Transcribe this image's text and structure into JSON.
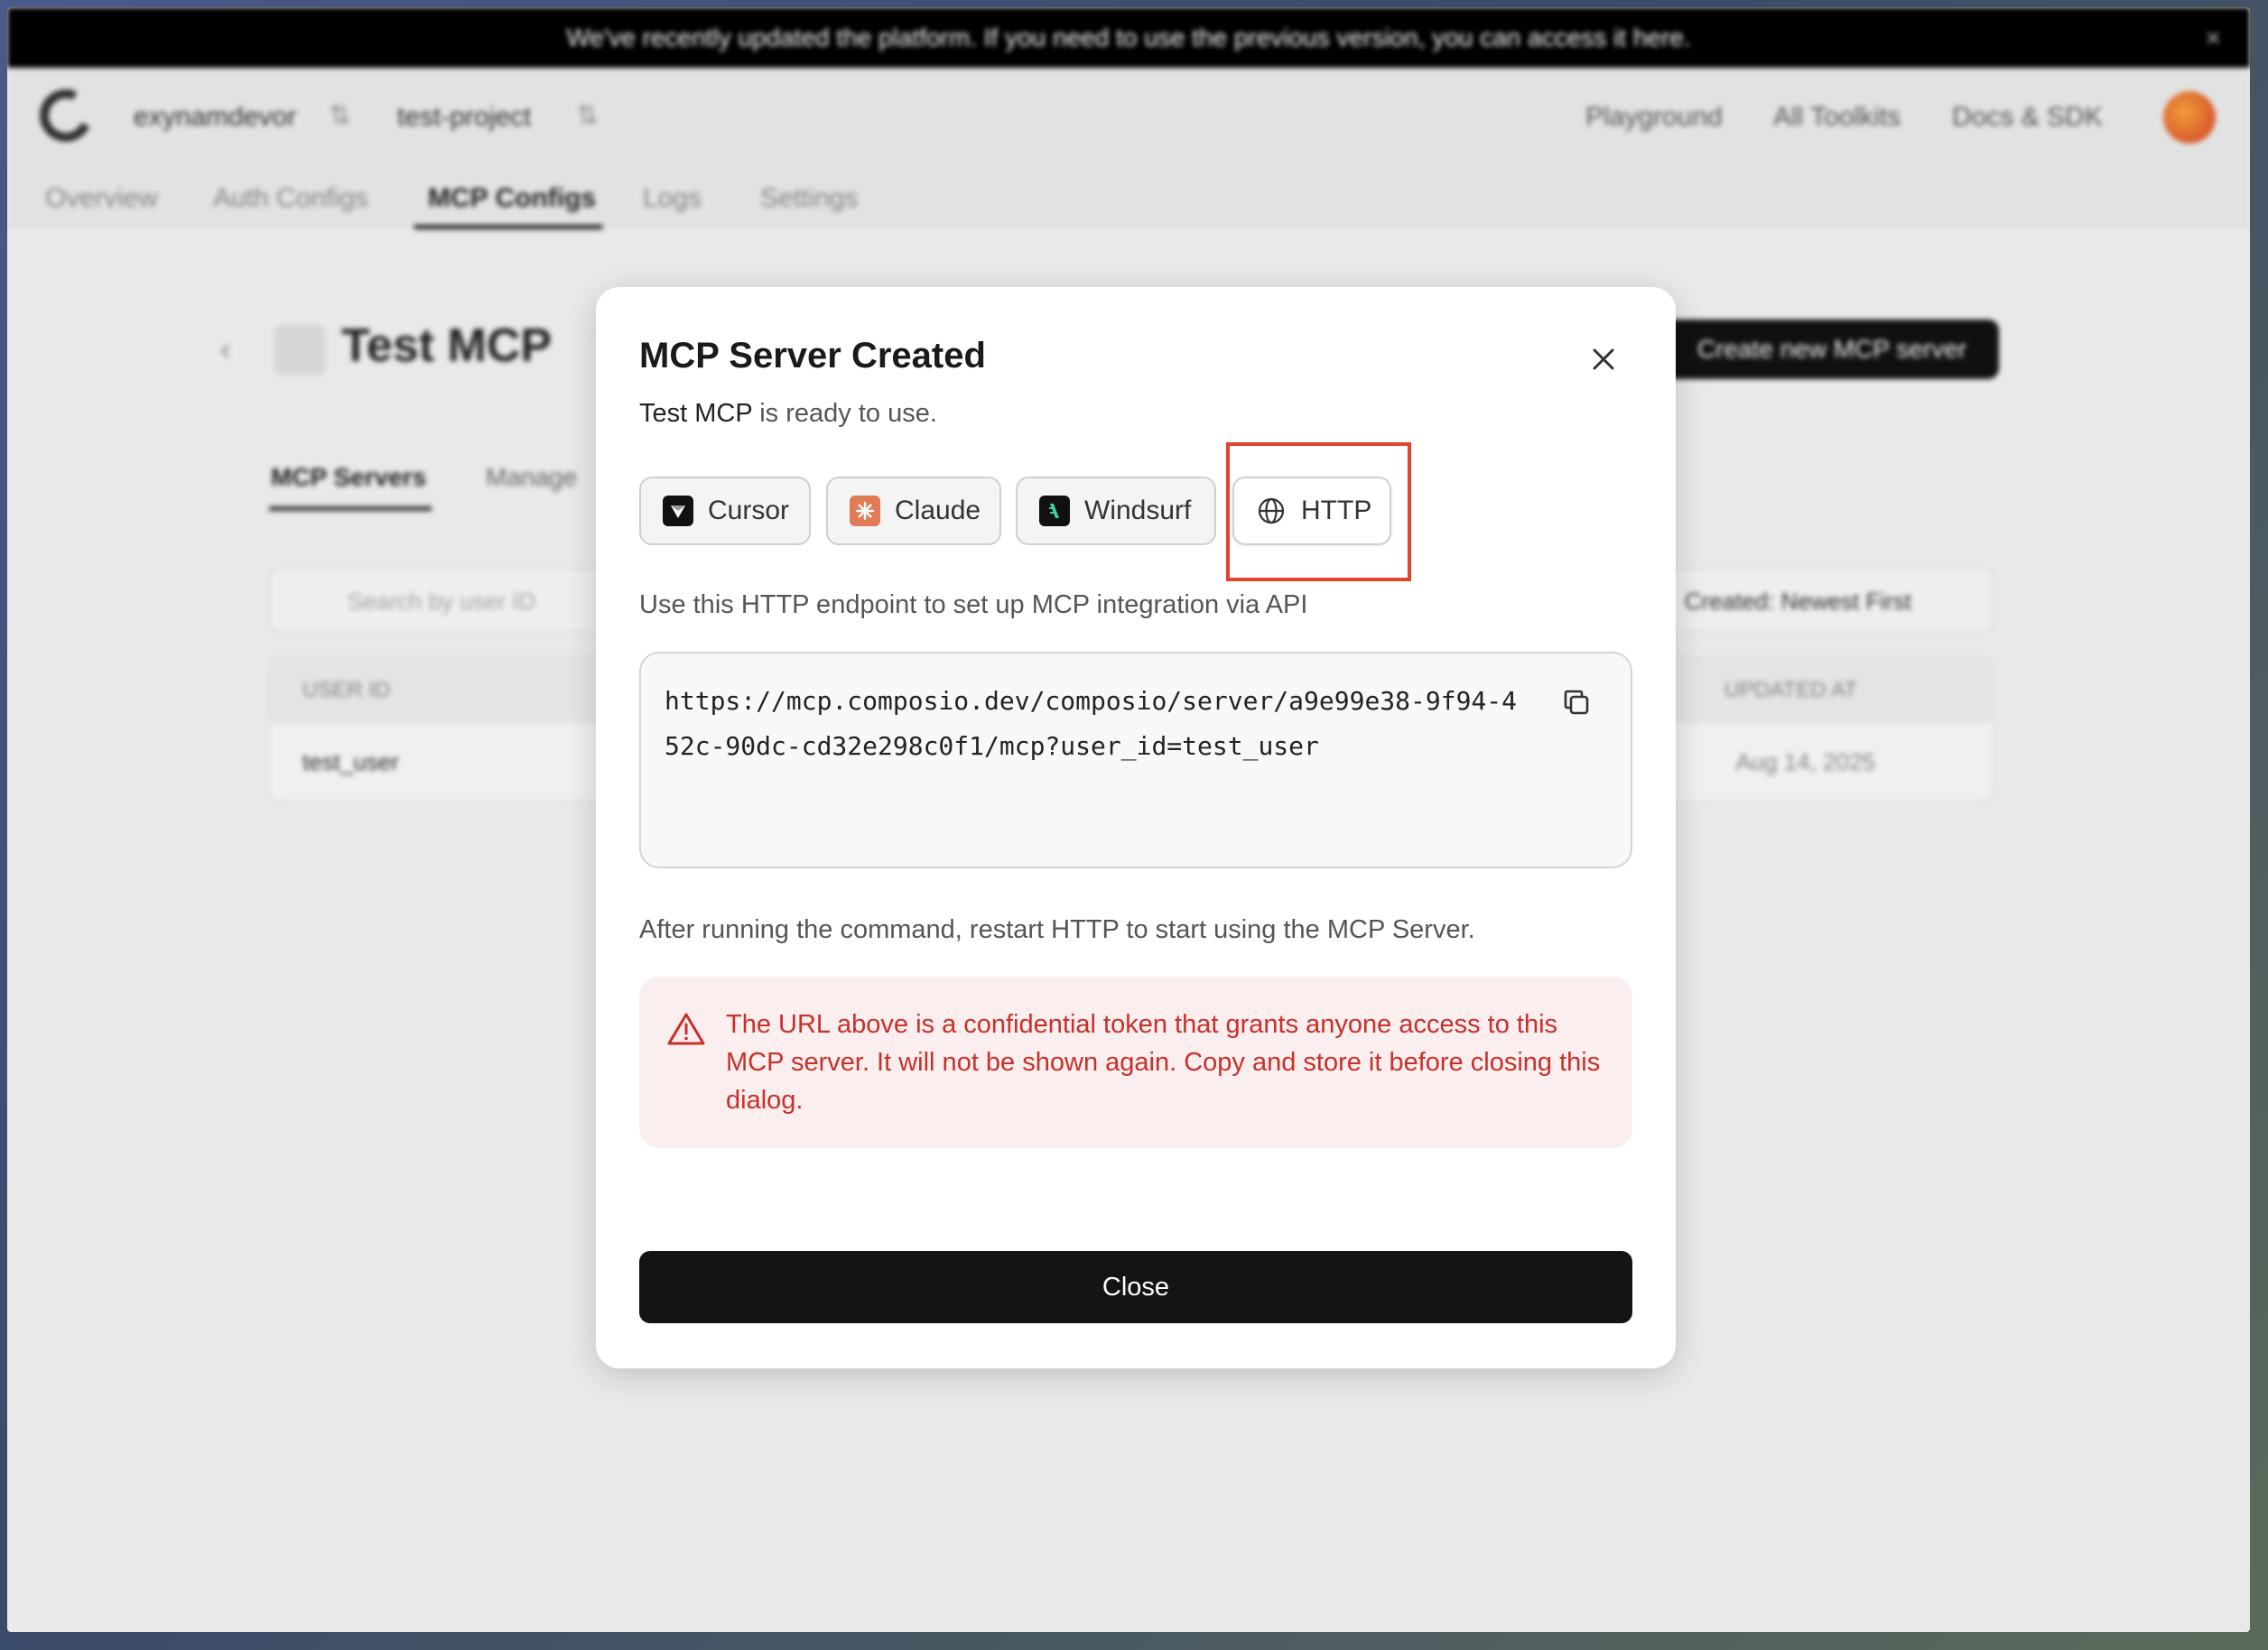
{
  "background": {
    "banner": {
      "text": "We've recently updated the platform. If you need to use the previous version, you can access it here.",
      "close": "×"
    },
    "nav": {
      "org": "exynamdevor",
      "project": "test-project",
      "links": [
        "Playground",
        "All Toolkits",
        "Docs & SDK"
      ],
      "tabs": [
        "Overview",
        "Auth Configs",
        "MCP Configs",
        "Logs",
        "Settings"
      ],
      "active_tab": "MCP Configs"
    },
    "page": {
      "title": "Test MCP",
      "create_button": "Create new MCP server",
      "inner_tabs": [
        "MCP Servers",
        "Manage"
      ],
      "search_placeholder": "Search by user ID",
      "sort_label": "Created: Newest First",
      "table_headers": [
        "USER ID",
        "UPDATED AT"
      ],
      "rows": [
        {
          "user_id": "test_user",
          "updated": "Aug 14, 2025"
        }
      ]
    }
  },
  "modal": {
    "title": "MCP Server Created",
    "subtitle_name": "Test MCP",
    "subtitle_rest": " is ready to use.",
    "clients": [
      {
        "label": "Cursor",
        "icon": "cursor-icon"
      },
      {
        "label": "Claude",
        "icon": "claude-icon"
      },
      {
        "label": "Windsurf",
        "icon": "windsurf-icon"
      },
      {
        "label": "HTTP",
        "icon": "globe-icon"
      }
    ],
    "selected_client": "HTTP",
    "endpoint_label": "Use this HTTP endpoint to set up MCP integration via API",
    "url": "https://mcp.composio.dev/composio/server/a9e99e38-9f94-452c-90dc-cd32e298c0f1/mcp?user_id=test_user",
    "after_text": "After running the command, restart HTTP to start using the MCP Server.",
    "warning": "The URL above is a confidential token that grants anyone access to this MCP server. It will not be shown again. Copy and store it before closing this dialog.",
    "close_button": "Close"
  },
  "colors": {
    "accent_dark": "#141414",
    "warning_bg": "#fbeeee",
    "warning_text": "#c8302a",
    "highlight": "#e0442a"
  }
}
